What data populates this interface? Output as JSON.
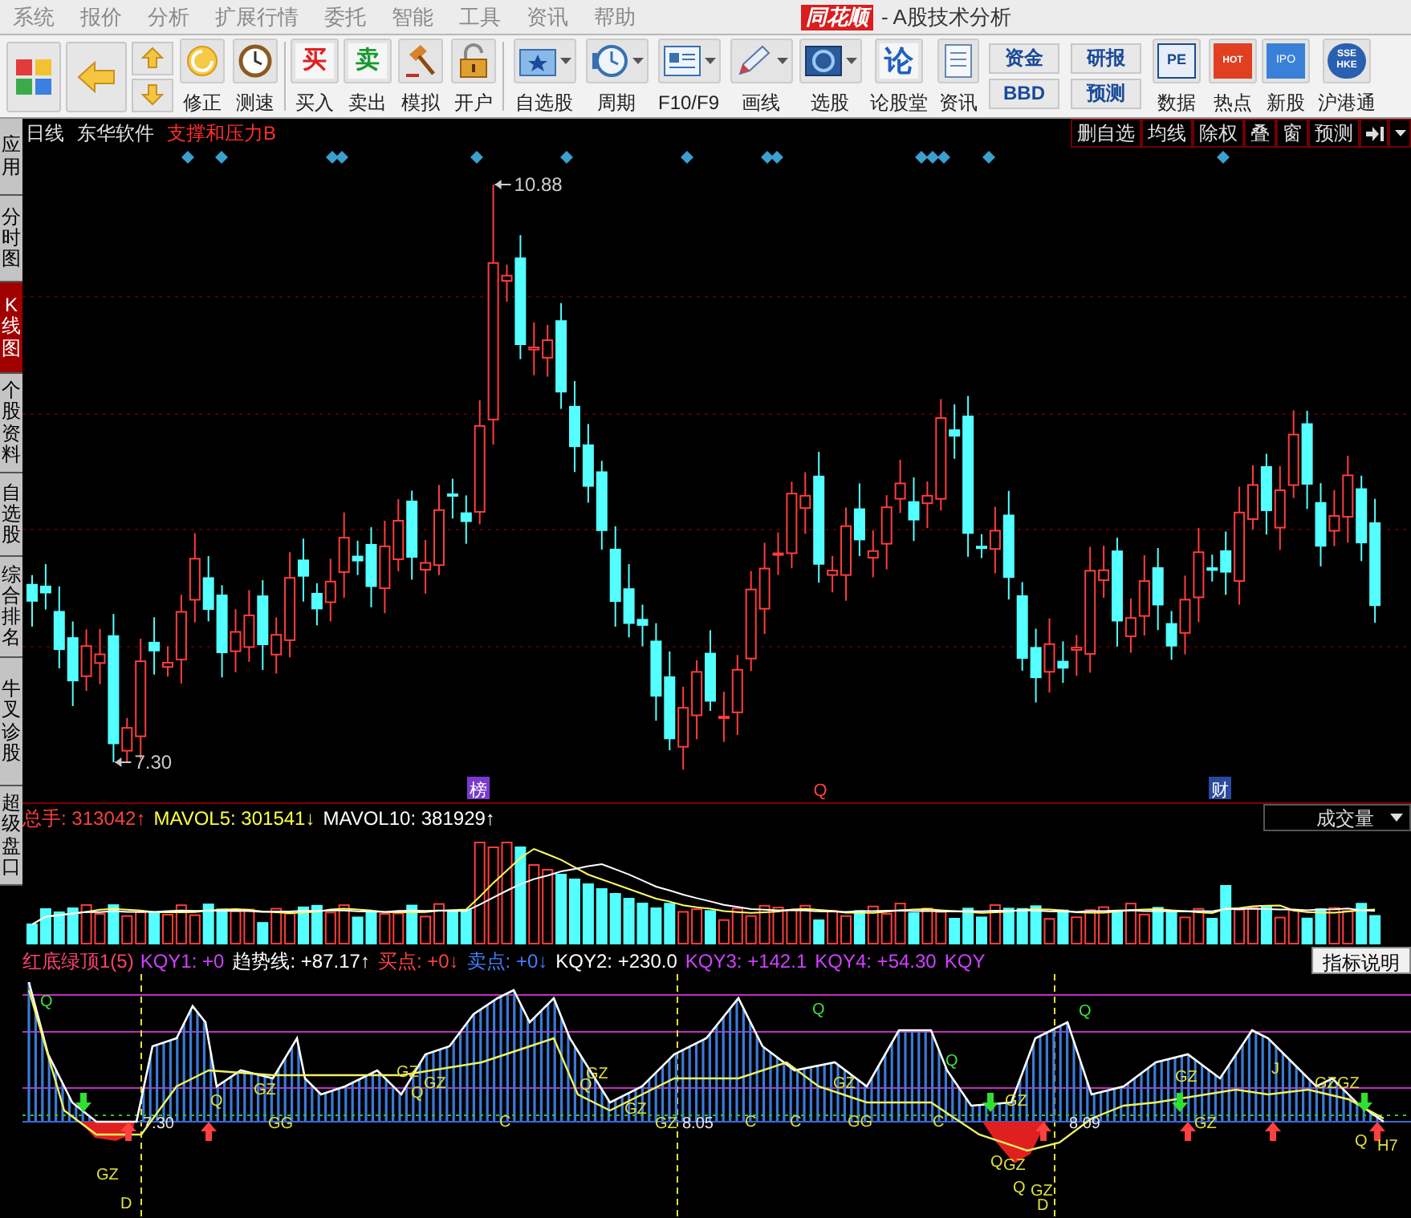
{
  "menu": [
    "系统",
    "报价",
    "分析",
    "扩展行情",
    "委托",
    "智能",
    "工具",
    "资讯",
    "帮助"
  ],
  "title_bar": {
    "logo": "同花顺",
    "title": "- A股技术分析"
  },
  "toolbar": [
    {
      "kind": "button",
      "label": "修正",
      "dropdown": false
    },
    {
      "kind": "button",
      "label": "测速",
      "dropdown": false
    },
    {
      "kind": "button",
      "label": "买入",
      "tile_text": "买",
      "dropdown": false
    },
    {
      "kind": "button",
      "label": "卖出",
      "tile_text": "卖",
      "dropdown": false
    },
    {
      "kind": "button",
      "label": "模拟",
      "dropdown": false
    },
    {
      "kind": "button",
      "label": "开户",
      "dropdown": false
    },
    {
      "kind": "button",
      "label": "自选股",
      "dropdown": true
    },
    {
      "kind": "button",
      "label": "周期",
      "dropdown": true
    },
    {
      "kind": "button",
      "label": "F10/F9",
      "dropdown": true
    },
    {
      "kind": "button",
      "label": "画线",
      "dropdown": true
    },
    {
      "kind": "button",
      "label": "选股",
      "dropdown": true
    },
    {
      "kind": "button",
      "label": "论股堂",
      "tile_text": "论",
      "dropdown": false
    },
    {
      "kind": "button",
      "label": "资讯",
      "dropdown": false
    },
    {
      "kind": "stack",
      "buttons": [
        "资金",
        "BBD"
      ]
    },
    {
      "kind": "stack",
      "buttons": [
        "研报",
        "预测"
      ]
    },
    {
      "kind": "button",
      "label": "数据",
      "tile_text": "PE",
      "dropdown": false
    },
    {
      "kind": "button",
      "label": "热点",
      "tile_text": "HOT",
      "dropdown": false
    },
    {
      "kind": "button",
      "label": "新股",
      "tile_text": "IPO",
      "dropdown": false
    },
    {
      "kind": "button",
      "label": "沪港通",
      "tile_text": "SSE HKE",
      "dropdown": false
    }
  ],
  "side_tabs": [
    {
      "label": "应用",
      "selected": false
    },
    {
      "label": "分时图",
      "selected": false
    },
    {
      "label": "K线图",
      "selected": true
    },
    {
      "label": "个股资料",
      "selected": false
    },
    {
      "label": "自选股",
      "selected": false
    },
    {
      "label": "综合排名",
      "selected": false
    },
    {
      "label": "牛叉诊股",
      "selected": false
    },
    {
      "label": "超级盘口",
      "selected": false
    }
  ],
  "chart": {
    "period": "日线",
    "stock": "东华软件",
    "indicator": "支撑和压力B",
    "buttons": [
      "删自选",
      "均线",
      "除权",
      "叠",
      "窗",
      "预测"
    ],
    "high_label": "10.88",
    "low_label": "7.30",
    "event_marks": [
      "榜",
      "Q",
      "财"
    ]
  },
  "volume": {
    "items": [
      {
        "text": "总手: 313042",
        "arrow": "↑",
        "color": "#ff4040"
      },
      {
        "text": "MAVOL5: 301541",
        "arrow": "↓",
        "color": "#ffff40"
      },
      {
        "text": "MAVOL10: 381929",
        "arrow": "↑",
        "color": "#ffffff"
      }
    ],
    "selector": "成交量"
  },
  "indicator": {
    "name": "红底绿顶1(5)",
    "items": [
      {
        "text": "KQY1: +0",
        "color": "#d040ff"
      },
      {
        "text": "趋势线: +87.17",
        "arrow": "↑",
        "color": "#ffffff"
      },
      {
        "text": "买点: +0",
        "arrow": "↓",
        "color": "#ff4040"
      },
      {
        "text": "卖点: +0",
        "arrow": "↓",
        "color": "#4080ff"
      },
      {
        "text": "KQY2: +230.0",
        "color": "#ffffff"
      },
      {
        "text": "KQY3: +142.1",
        "color": "#d040ff"
      },
      {
        "text": "KQY4: +54.30",
        "color": "#d040ff"
      },
      {
        "text": "KQY",
        "color": "#d040ff"
      }
    ],
    "help_button": "指标说明",
    "labels": [
      "Q",
      "GZ",
      "D",
      "7.30",
      "Q",
      "GZ",
      "GG",
      "GZ",
      "Q",
      "GZ",
      "C",
      "Q",
      "GZ",
      "GZ",
      "GZ",
      "8.05",
      "C",
      "C",
      "Q",
      "GZ",
      "GG",
      "C",
      "Q",
      "GZ",
      "Q",
      "GZ",
      "Q",
      "GZ",
      "D",
      "8.09",
      "Q",
      "GZ",
      "GZ",
      "J",
      "GZ",
      "GZ",
      "Q",
      "H7"
    ]
  }
}
